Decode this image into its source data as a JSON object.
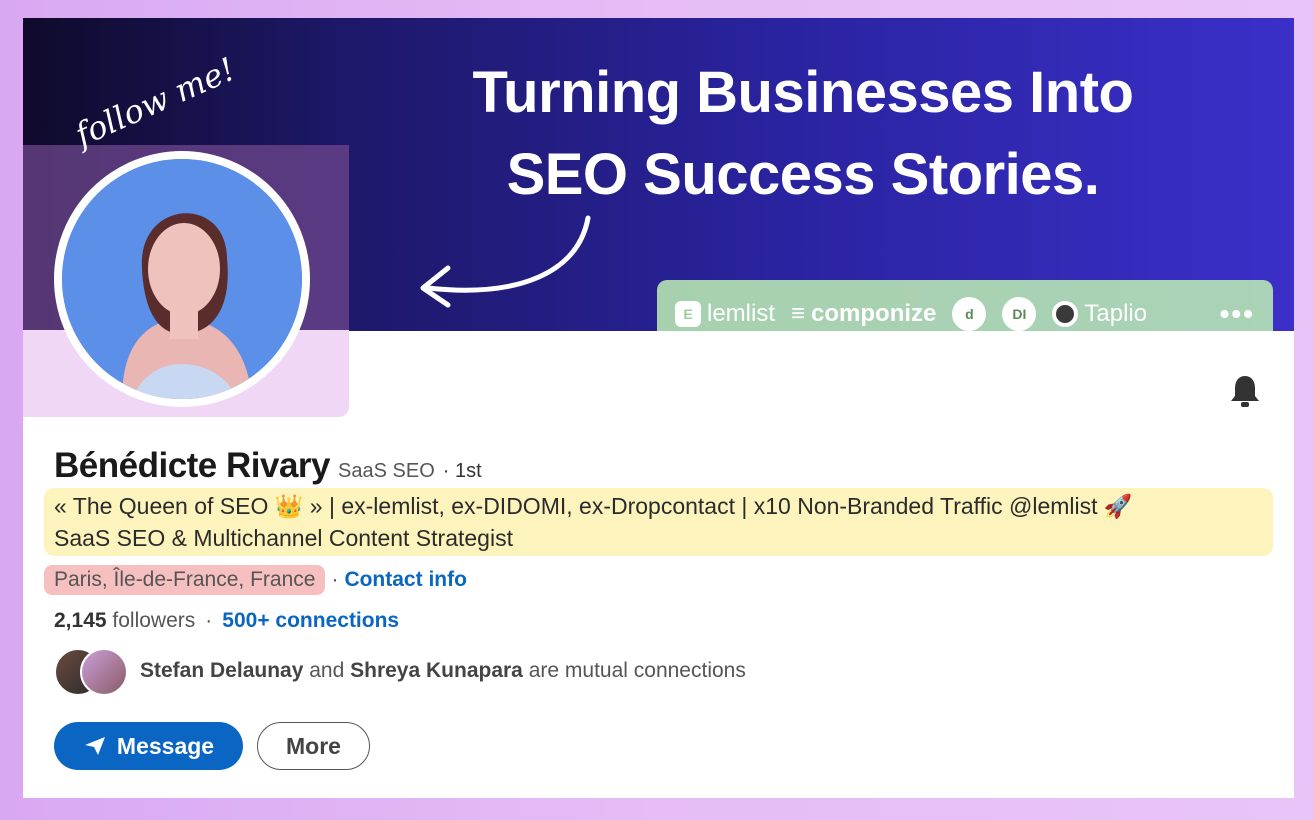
{
  "banner": {
    "headline_line1": "Turning Businesses Into",
    "headline_line2": "SEO Success Stories.",
    "follow_text": "follow me!",
    "partners": [
      "lemlist",
      "componize",
      "d",
      "DI",
      "Taplio"
    ],
    "more_glyph": "•••",
    "highlight_color": "#c6f0bb"
  },
  "profile": {
    "name": "Bénédicte Rivary",
    "subtitle": "SaaS SEO",
    "degree": "· 1st",
    "headline_line1": "« The Queen of SEO 👑 » | ex-lemlist, ex-DIDOMI, ex-Dropcontact | x10 Non-Branded Traffic @lemlist 🚀",
    "headline_line2": "SaaS SEO & Multichannel Content Strategist",
    "location": "Paris, Île-de-France, France",
    "contact_info": "Contact info",
    "followers_count": "2,145",
    "followers_label": "followers",
    "connections": "500+ connections",
    "mutual_name1": "Stefan Delaunay",
    "mutual_and": "and",
    "mutual_name2": "Shreya Kunapara",
    "mutual_suffix": "are mutual connections"
  },
  "actions": {
    "message_label": "Message",
    "more_label": "More"
  },
  "icons": {
    "bell": "bell-icon",
    "send": "send-icon"
  },
  "colors": {
    "brand_blue": "#0a66c2",
    "headline_highlight": "#fdf3bd",
    "location_highlight": "#f6c0c0"
  }
}
